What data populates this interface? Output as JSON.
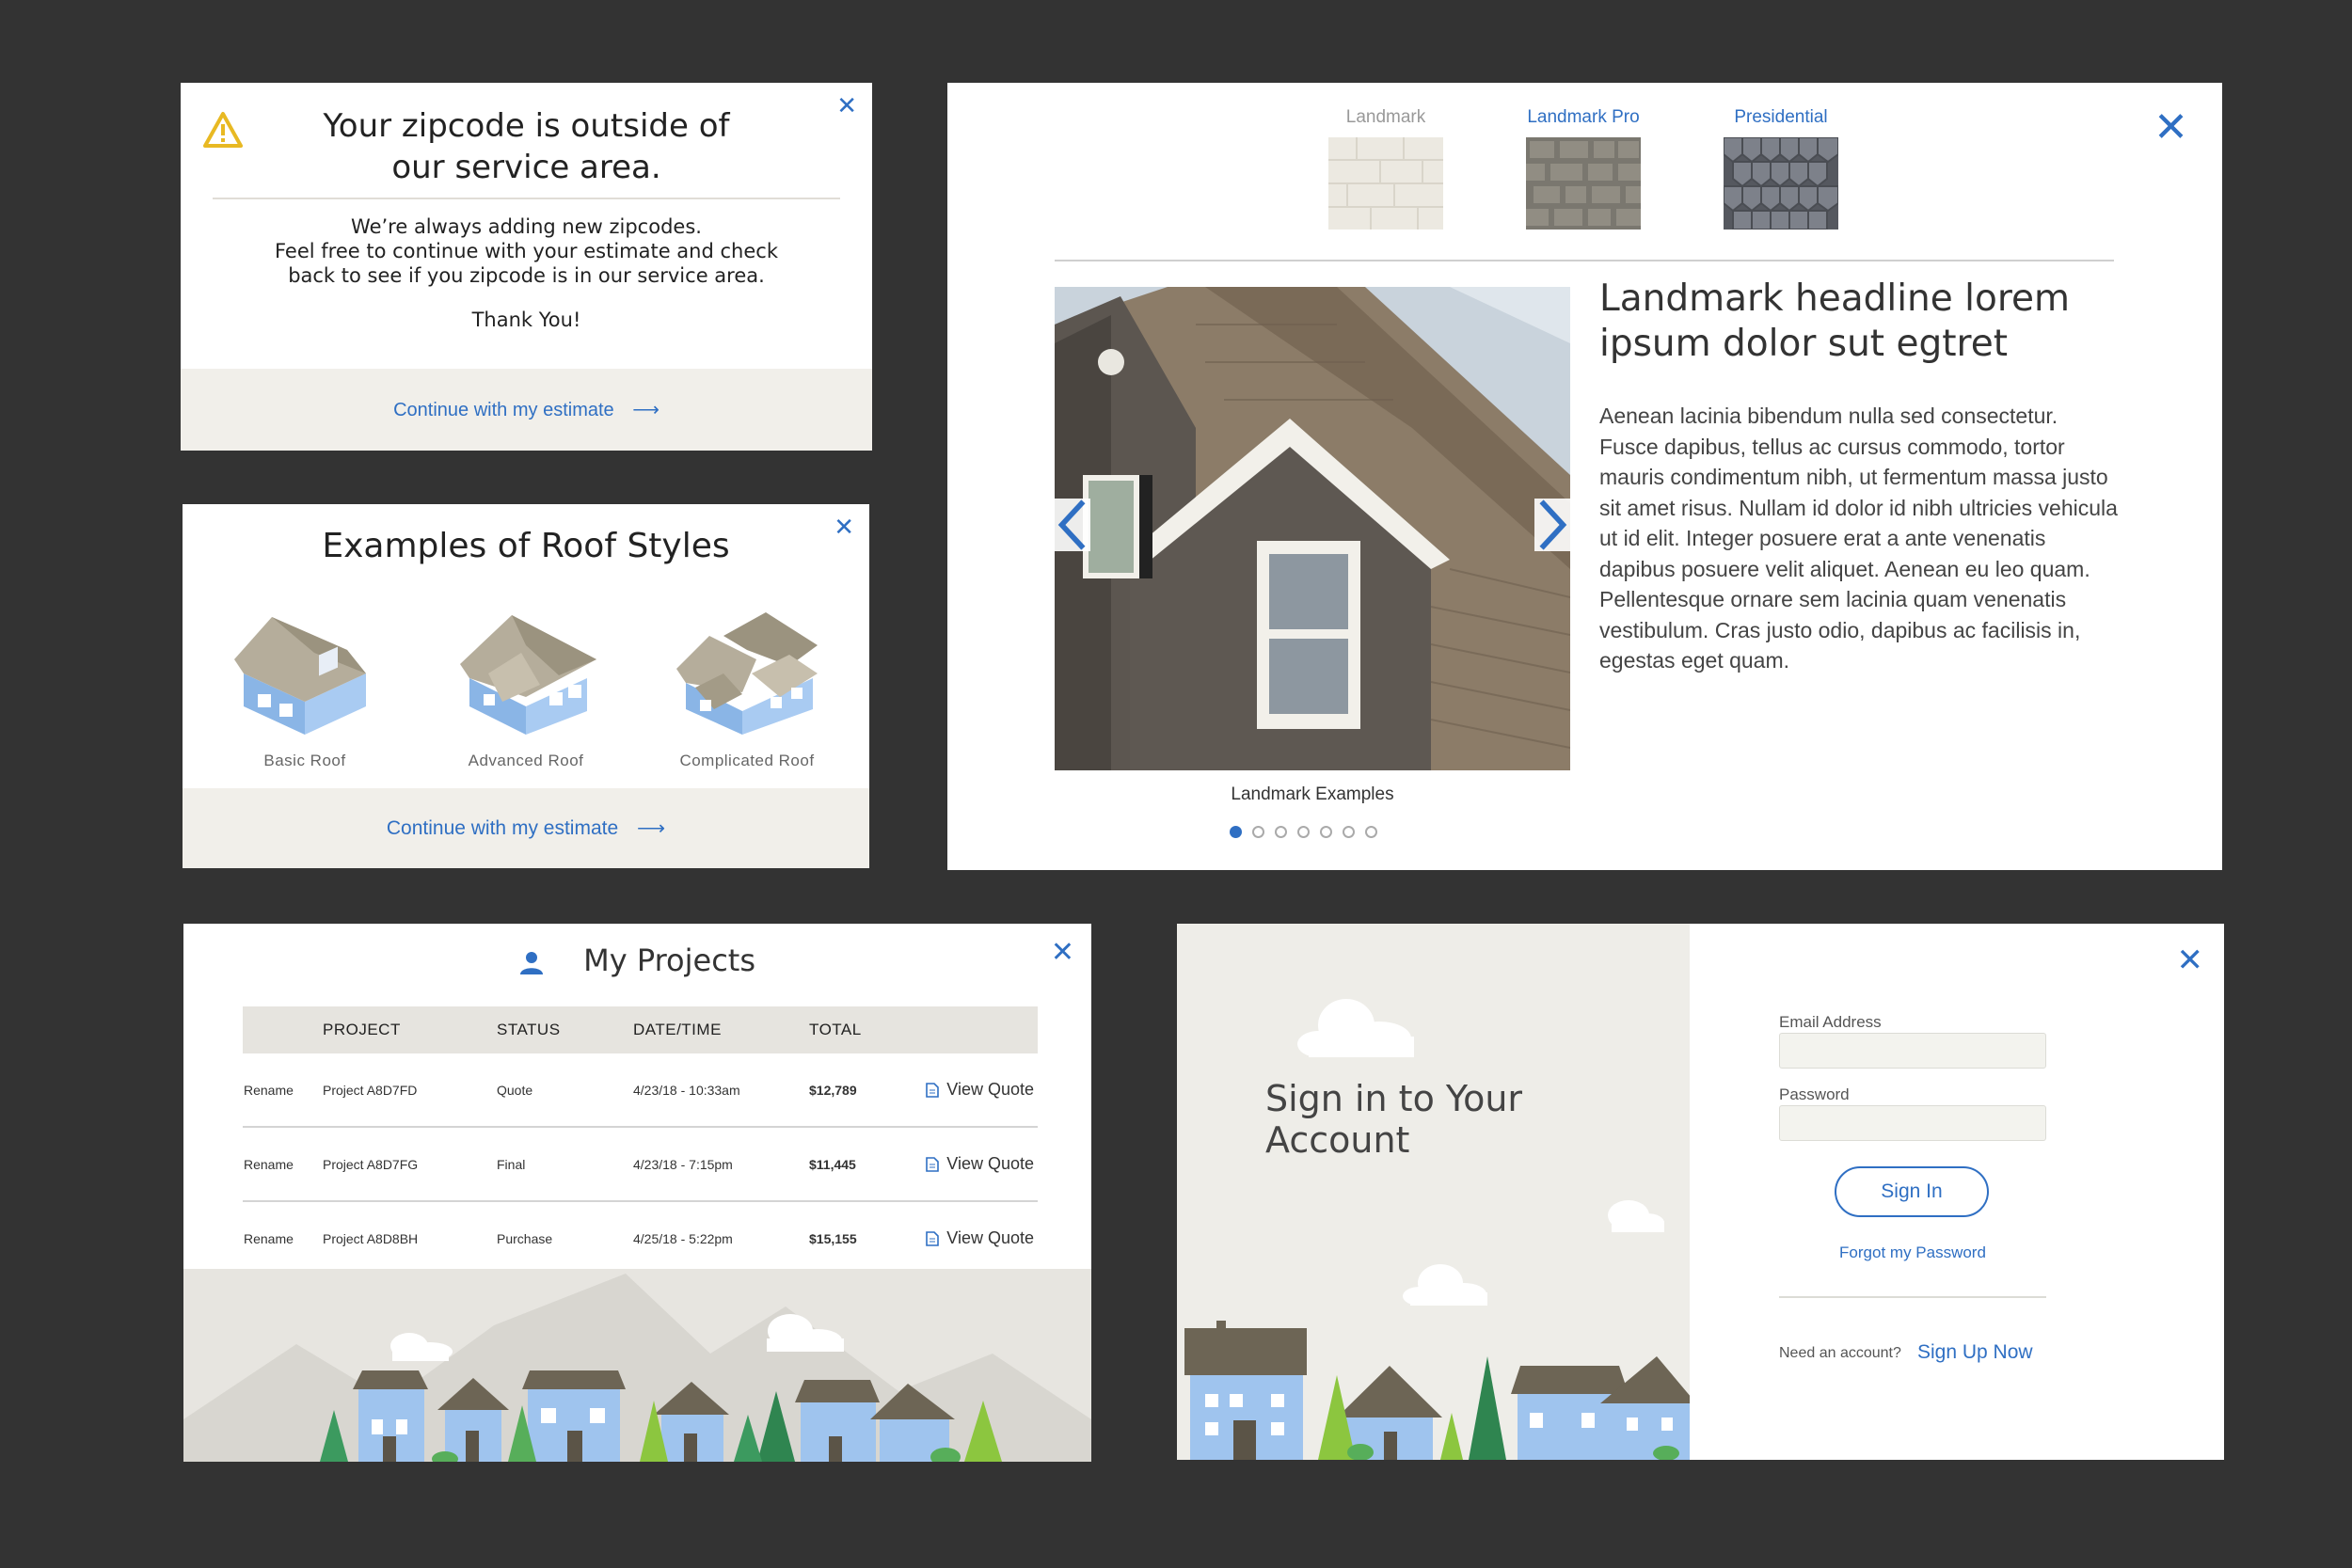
{
  "zip_modal": {
    "title_line1": "Your zipcode is outside of",
    "title_line2": "our service area.",
    "body_line1": "We’re always adding new zipcodes.",
    "body_line2": "Feel free to continue with your estimate and check",
    "body_line3": "back to see if you zipcode is in our service area.",
    "thanks": "Thank You!",
    "continue_label": "Continue with my estimate",
    "arrow": "⟶",
    "close": "✕"
  },
  "roof_styles_modal": {
    "title": "Examples of Roof Styles",
    "styles": [
      {
        "label": "Basic Roof"
      },
      {
        "label": "Advanced Roof"
      },
      {
        "label": "Complicated Roof"
      }
    ],
    "continue_label": "Continue with my estimate",
    "arrow": "⟶",
    "close": "✕"
  },
  "product_modal": {
    "tabs": [
      {
        "label": "Landmark",
        "color": "#999999"
      },
      {
        "label": "Landmark Pro",
        "color": "#2f6fc3"
      },
      {
        "label": "Presidential",
        "color": "#2f6fc3"
      }
    ],
    "headline": "Landmark headline lorem ipsum dolor sut egtret",
    "paragraph": "Aenean lacinia bibendum nulla sed consectetur. Fusce dapibus, tellus ac cursus commodo, tortor mauris condimentum nibh, ut fermentum massa justo sit amet risus. Nullam id dolor id nibh ultricies vehicula ut id elit. Integer posuere erat a ante venenatis dapibus posuere velit aliquet. Aenean eu leo quam. Pellentesque ornare sem lacinia quam venenatis vestibulum. Cras justo odio, dapibus ac facilisis in, egestas eget quam.",
    "caption": "Landmark Examples",
    "slide_count": 7,
    "active_slide": 1,
    "close": "✕"
  },
  "projects_modal": {
    "title": "My Projects",
    "columns": [
      "PROJECT",
      "STATUS",
      "DATE/TIME",
      "TOTAL"
    ],
    "rows": [
      {
        "action": "Rename",
        "project": "Project A8D7FD",
        "status": "Quote",
        "datetime": "4/23/18 - 10:33am",
        "total": "$12,789",
        "view": "View Quote"
      },
      {
        "action": "Rename",
        "project": "Project A8D7FG",
        "status": "Final",
        "datetime": "4/23/18 - 7:15pm",
        "total": "$11,445",
        "view": "View Quote"
      },
      {
        "action": "Rename",
        "project": "Project A8D8BH",
        "status": "Purchase",
        "datetime": "4/25/18 - 5:22pm",
        "total": "$15,155",
        "view": "View Quote"
      }
    ],
    "close": "✕"
  },
  "signin_modal": {
    "title_line1": "Sign in to Your",
    "title_line2": "Account",
    "email_label": "Email Address",
    "email_value": "",
    "password_label": "Password",
    "password_value": "",
    "signin_button": "Sign In",
    "forgot_link": "Forgot my Password",
    "need_account": "Need an account?",
    "signup_link": "Sign Up Now",
    "close": "✕"
  },
  "colors": {
    "accent": "#2f6fc3",
    "background": "#333333",
    "footer_beige": "#f1efea",
    "house_blue": "#9fc4ee",
    "roof_brown": "#6d6555",
    "tree_green": "#3c9a5f"
  }
}
